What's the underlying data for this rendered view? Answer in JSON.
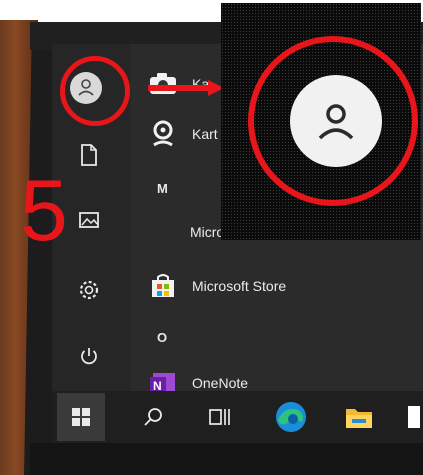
{
  "annotation": {
    "step_number": "5"
  },
  "start_menu": {
    "rail": {
      "items": [
        {
          "name": "account",
          "icon": "user-icon"
        },
        {
          "name": "documents",
          "icon": "document-icon"
        },
        {
          "name": "pictures",
          "icon": "pictures-icon"
        },
        {
          "name": "settings",
          "icon": "gear-icon"
        },
        {
          "name": "power",
          "icon": "power-icon"
        }
      ]
    },
    "apps": [
      {
        "label": "Ka",
        "icon": "camera-icon"
      },
      {
        "label": "Kart",
        "icon": "maps-icon"
      },
      {
        "label": "Microsoft Edge",
        "icon": "edge-icon"
      },
      {
        "label": "Microsoft Store",
        "icon": "store-icon"
      },
      {
        "label": "OneNote",
        "icon": "onenote-icon"
      }
    ],
    "letters": [
      "M",
      "O"
    ],
    "partial_label": "Microsoft Edge"
  },
  "taskbar": {
    "items": [
      {
        "name": "start",
        "icon": "windows-icon"
      },
      {
        "name": "search",
        "icon": "search-icon"
      },
      {
        "name": "task-view",
        "icon": "task-view-icon"
      },
      {
        "name": "edge",
        "icon": "edge-icon"
      },
      {
        "name": "file-explorer",
        "icon": "folder-icon"
      }
    ]
  },
  "colors": {
    "annotation_red": "#e8161a",
    "menu_bg": "#2b2b2b",
    "taskbar_bg": "#1f1f1f"
  }
}
